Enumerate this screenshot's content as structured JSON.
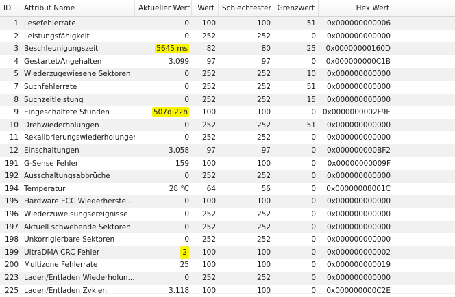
{
  "columns": {
    "id": "ID",
    "name": "Attribut Name",
    "current": "Aktueller Wert",
    "wert": "Wert",
    "schlecht": "Schlechtester",
    "grenz": "Grenzwert",
    "hex": "Hex Wert"
  },
  "rows": [
    {
      "id": "1",
      "name": "Lesefehlerrate",
      "current": "0",
      "wert": "100",
      "schlecht": "100",
      "grenz": "51",
      "hex": "0x000000000006"
    },
    {
      "id": "2",
      "name": "Leistungsfähigkeit",
      "current": "0",
      "wert": "252",
      "schlecht": "252",
      "grenz": "0",
      "hex": "0x000000000000"
    },
    {
      "id": "3",
      "name": "Beschleunigungszeit",
      "current": "5645 ms",
      "wert": "82",
      "schlecht": "80",
      "grenz": "25",
      "hex": "0x00000000160D",
      "highlight": true
    },
    {
      "id": "4",
      "name": "Gestartet/Angehalten",
      "current": "3.099",
      "wert": "97",
      "schlecht": "97",
      "grenz": "0",
      "hex": "0x000000000C1B"
    },
    {
      "id": "5",
      "name": "Wiederzugewiesene Sektoren",
      "current": "0",
      "wert": "252",
      "schlecht": "252",
      "grenz": "10",
      "hex": "0x000000000000"
    },
    {
      "id": "7",
      "name": "Suchfehlerrate",
      "current": "0",
      "wert": "252",
      "schlecht": "252",
      "grenz": "51",
      "hex": "0x000000000000"
    },
    {
      "id": "8",
      "name": "Suchzeitleistung",
      "current": "0",
      "wert": "252",
      "schlecht": "252",
      "grenz": "15",
      "hex": "0x000000000000"
    },
    {
      "id": "9",
      "name": "Eingeschaltete Stunden",
      "current": "507d 22h",
      "wert": "100",
      "schlecht": "100",
      "grenz": "0",
      "hex": "0x0000000002F9E",
      "highlight": true
    },
    {
      "id": "10",
      "name": "Drehwiederholungen",
      "current": "0",
      "wert": "252",
      "schlecht": "252",
      "grenz": "51",
      "hex": "0x000000000000"
    },
    {
      "id": "11",
      "name": "Rekalibrierungswiederholungen",
      "current": "0",
      "wert": "252",
      "schlecht": "252",
      "grenz": "0",
      "hex": "0x000000000000"
    },
    {
      "id": "12",
      "name": "Einschaltungen",
      "current": "3.058",
      "wert": "97",
      "schlecht": "97",
      "grenz": "0",
      "hex": "0x000000000BF2"
    },
    {
      "id": "191",
      "name": "G-Sense Fehler",
      "current": "159",
      "wert": "100",
      "schlecht": "100",
      "grenz": "0",
      "hex": "0x00000000009F"
    },
    {
      "id": "192",
      "name": "Ausschaltungsabbrüche",
      "current": "0",
      "wert": "252",
      "schlecht": "252",
      "grenz": "0",
      "hex": "0x000000000000"
    },
    {
      "id": "194",
      "name": "Temperatur",
      "current": "28 °C",
      "wert": "64",
      "schlecht": "56",
      "grenz": "0",
      "hex": "0x00000008001C"
    },
    {
      "id": "195",
      "name": "Hardware ECC Wiederherste...",
      "current": "0",
      "wert": "100",
      "schlecht": "100",
      "grenz": "0",
      "hex": "0x000000000000"
    },
    {
      "id": "196",
      "name": "Wiederzuweisungsereignisse",
      "current": "0",
      "wert": "252",
      "schlecht": "252",
      "grenz": "0",
      "hex": "0x000000000000"
    },
    {
      "id": "197",
      "name": "Aktuell schwebende Sektoren",
      "current": "0",
      "wert": "252",
      "schlecht": "252",
      "grenz": "0",
      "hex": "0x000000000000"
    },
    {
      "id": "198",
      "name": "Unkorrigierbare Sektoren",
      "current": "0",
      "wert": "252",
      "schlecht": "252",
      "grenz": "0",
      "hex": "0x000000000000"
    },
    {
      "id": "199",
      "name": "UltraDMA CRC Fehler",
      "current": "2",
      "wert": "100",
      "schlecht": "100",
      "grenz": "0",
      "hex": "0x000000000002",
      "highlight": true
    },
    {
      "id": "200",
      "name": "Multizone Fehlerrate",
      "current": "25",
      "wert": "100",
      "schlecht": "100",
      "grenz": "0",
      "hex": "0x000000000019"
    },
    {
      "id": "223",
      "name": "Laden/Entladen Wiederholun...",
      "current": "0",
      "wert": "252",
      "schlecht": "252",
      "grenz": "0",
      "hex": "0x000000000000"
    },
    {
      "id": "225",
      "name": "Laden/Entladen Zyklen",
      "current": "3.118",
      "wert": "100",
      "schlecht": "100",
      "grenz": "0",
      "hex": "0x000000000C2E"
    }
  ],
  "colors": {
    "highlight": "#f8f400",
    "row_alt": "#f1f1f1"
  }
}
